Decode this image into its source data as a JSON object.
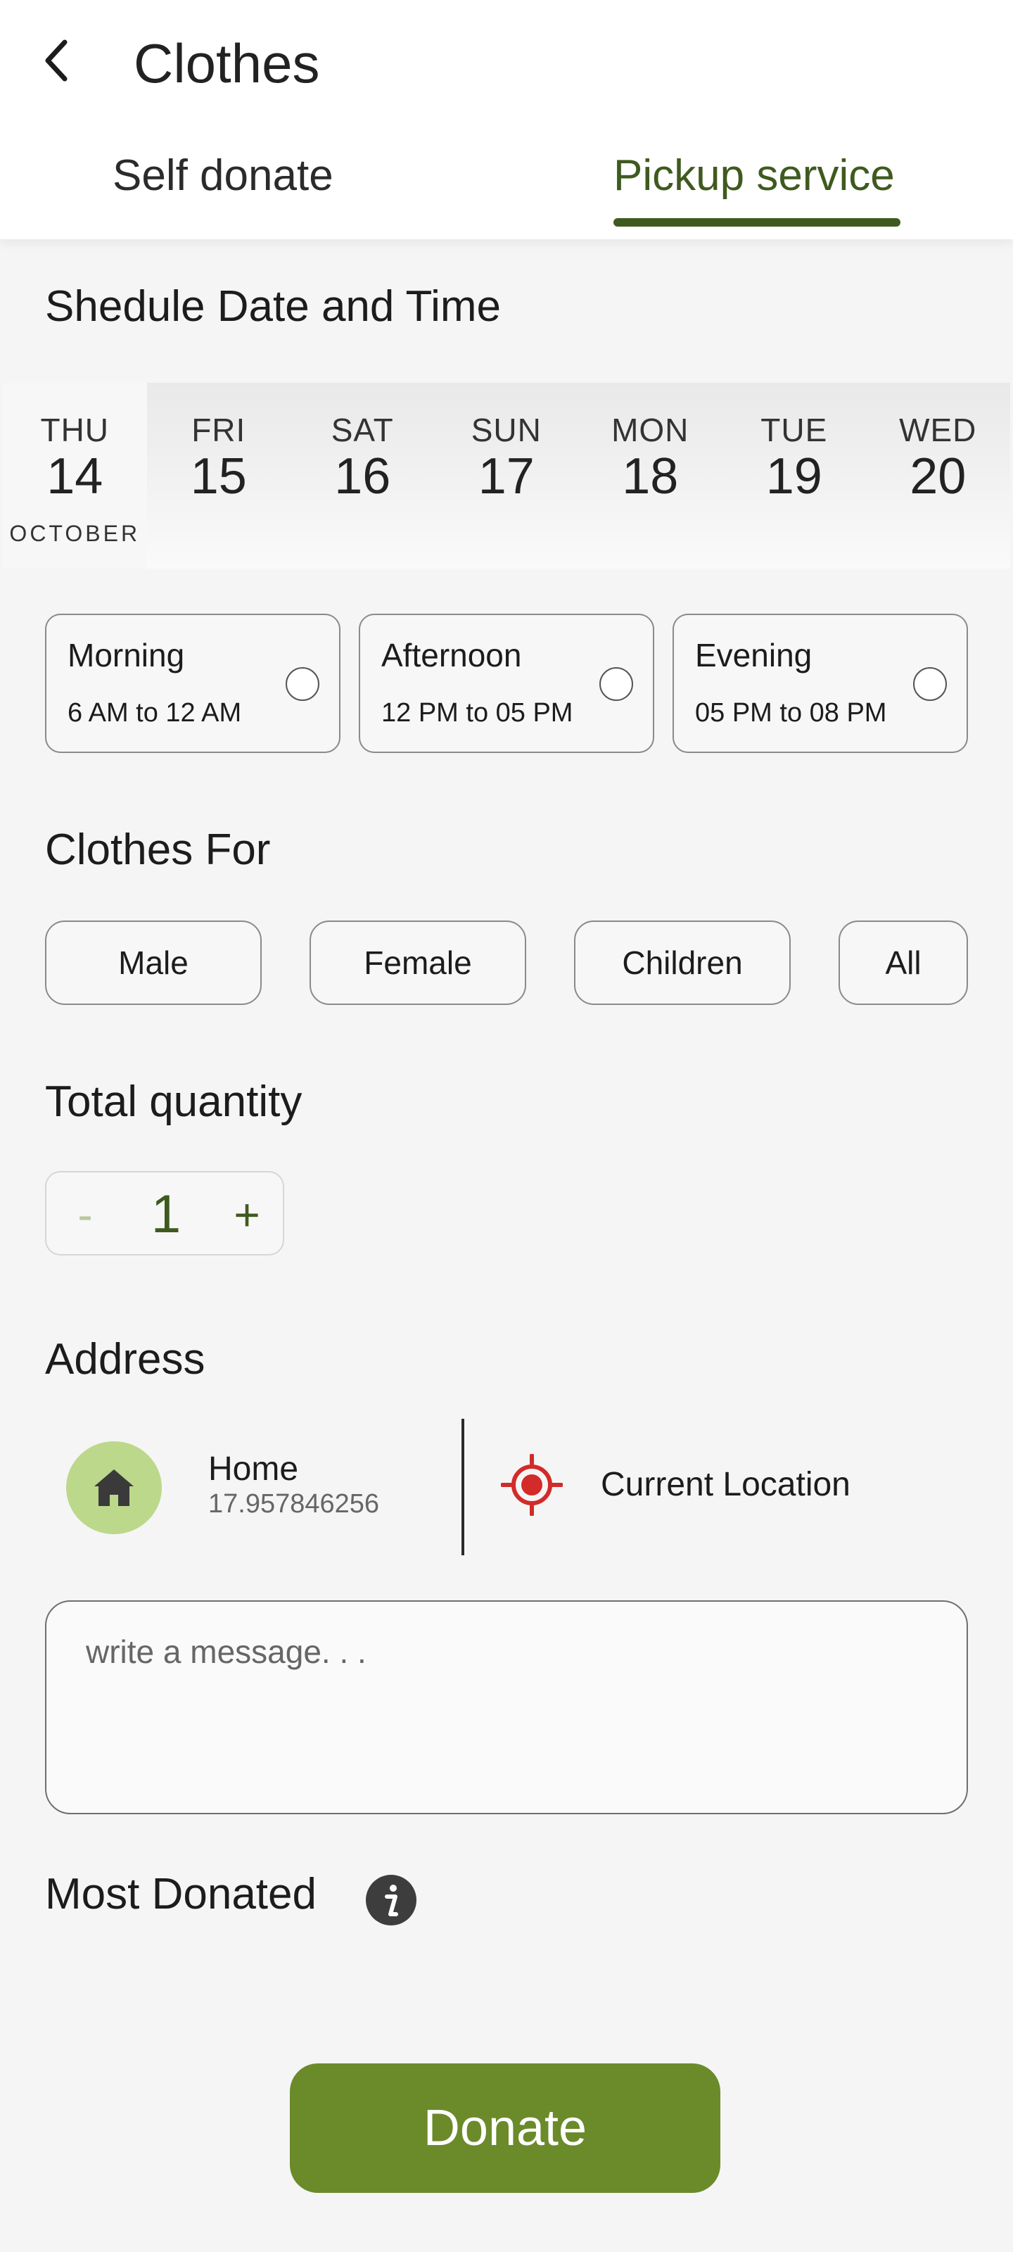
{
  "header": {
    "title": "Clothes",
    "tabs": [
      {
        "label": "Self donate",
        "active": false
      },
      {
        "label": "Pickup service",
        "active": true
      }
    ]
  },
  "schedule": {
    "title": "Shedule Date and Time",
    "dates": [
      {
        "day": "THU",
        "num": "14",
        "month": "OCTOBER",
        "selected": true
      },
      {
        "day": "FRI",
        "num": "15",
        "month": "",
        "selected": false
      },
      {
        "day": "SAT",
        "num": "16",
        "month": "",
        "selected": false
      },
      {
        "day": "SUN",
        "num": "17",
        "month": "",
        "selected": false
      },
      {
        "day": "MON",
        "num": "18",
        "month": "",
        "selected": false
      },
      {
        "day": "TUE",
        "num": "19",
        "month": "",
        "selected": false
      },
      {
        "day": "WED",
        "num": "20",
        "month": "",
        "selected": false
      }
    ],
    "slots": [
      {
        "name": "Morning",
        "time": "6 AM to 12 AM",
        "selected": false
      },
      {
        "name": "Afternoon",
        "time": "12 PM to 05 PM",
        "selected": false
      },
      {
        "name": "Evening",
        "time": "05 PM to 08 PM",
        "selected": false
      }
    ]
  },
  "clothes_for": {
    "title": "Clothes For",
    "options": [
      "Male",
      "Female",
      "Children",
      "All"
    ]
  },
  "quantity": {
    "title": "Total quantity",
    "minus": "-",
    "value": "1",
    "plus": "+"
  },
  "address": {
    "title": "Address",
    "home_label": "Home",
    "home_coord": "17.957846256",
    "current_label": "Current Location"
  },
  "message": {
    "placeholder": "write a message. . ."
  },
  "most_donated": {
    "title": "Most Donated"
  },
  "donate_button": "Donate",
  "colors": {
    "accent": "#3f5a1e",
    "button": "#6b8a2a",
    "home_icon_bg": "#bcd88a",
    "location_red": "#d32a2a"
  },
  "icons": {
    "back": "chevron-left-icon",
    "home": "home-icon",
    "location": "target-icon",
    "info": "info-icon"
  }
}
